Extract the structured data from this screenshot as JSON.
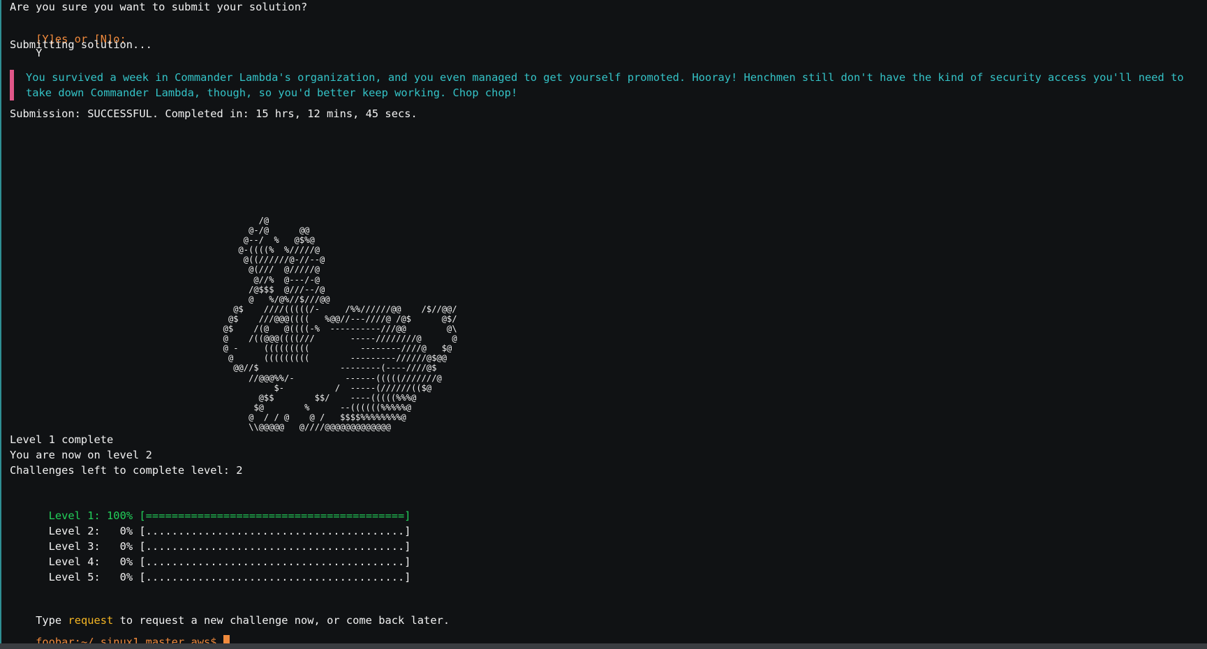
{
  "terminal": {
    "confirm_question": "Are you sure you want to submit your solution?",
    "prompt_options": "[Y]es or [N]o:",
    "prompt_answer": "Y",
    "submitting": "Submitting solution...",
    "message": "You survived a week in Commander Lambda's organization, and you even managed to get yourself promoted. Hooray! Henchmen still don't have the kind of security access you'll need to take down Commander Lambda, though, so you'd better keep working. Chop chop!",
    "submission_result": "Submission: SUCCESSFUL. Completed in: 15 hrs, 12 mins, 45 secs.",
    "ascii_art": "             /@\n           @-/@      @@\n          @--/  %   @$%@\n         @-((((%  %/////@\n          @((//////@-//--@\n           @(///  @/////@\n            @//%  @---/-@\n           /@$$$  @///--/@\n           @   %/@%//$///@@\n        @$    ////(((((/-     /%%//////@@    /$//@@/\n       @$    ///@@@((((   %@@//---////@ /@$      @$/\n      @$    /(@   @((((-%  ----------///@@        @\\\n      @    /((@@@((((///       -----////////@      @\n      @ -     (((((((((          --------////@   $@\n       @      (((((((((        ---------//////@$@@\n        @@//$                --------(----////@$\n           //@@@%%/-          ------(((((///////@\n                $-          /  -----(//////(($@\n             @$$        $$/    ----(((((%%%@\n            $@        %      --((((((%%%%%@\n           @  / / @    @ /   $$$$%%%%%%%%@\n           \\\\@@@@@   @////@@@@@@@@@@@@@",
    "level_status": [
      "Level 1 complete",
      "You are now on level 2",
      "Challenges left to complete level: 2"
    ],
    "progress": [
      {
        "label": "Level 1:",
        "percent": "100%",
        "bar": "[========================================]",
        "complete": true
      },
      {
        "label": "Level 2:",
        "percent": "0%",
        "bar": "[........................................]",
        "complete": false
      },
      {
        "label": "Level 3:",
        "percent": "0%",
        "bar": "[........................................]",
        "complete": false
      },
      {
        "label": "Level 4:",
        "percent": "0%",
        "bar": "[........................................]",
        "complete": false
      },
      {
        "label": "Level 5:",
        "percent": "0%",
        "bar": "[........................................]",
        "complete": false
      }
    ],
    "instruction": {
      "prefix": "Type ",
      "command": "request",
      "suffix": " to request a new challenge now, or come back later."
    },
    "shell_prompt": "foobar:~/ sinux1.master.aws$"
  },
  "colors": {
    "background": "#101214",
    "text": "#f2f2f2",
    "prompt": "#f08a3c",
    "message": "#34c3c7",
    "accent_bar": "#e05688",
    "success": "#22d15a",
    "command": "#f5b623"
  }
}
